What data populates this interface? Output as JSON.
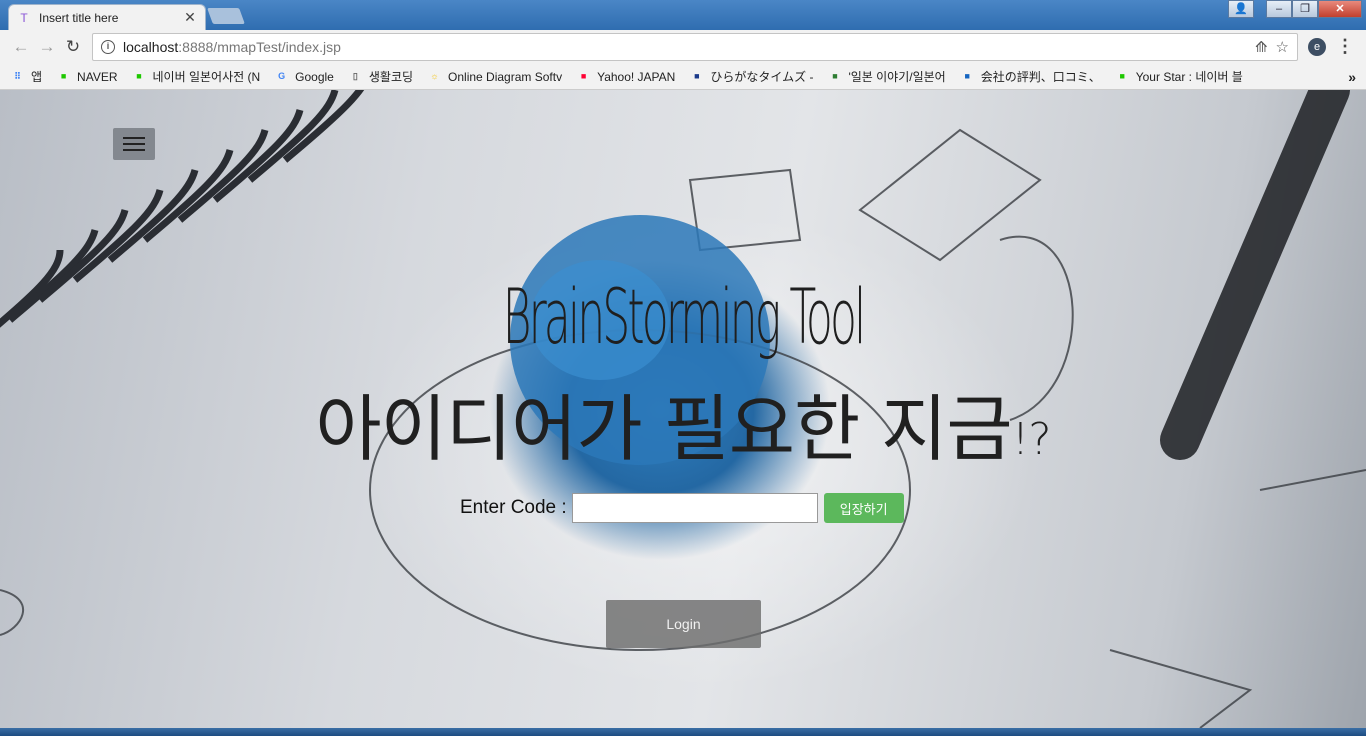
{
  "browser": {
    "tab": {
      "title": "Insert title here",
      "favicon": "T"
    },
    "address": {
      "host": "localhost",
      "path": ":8888/mmapTest/index.jsp"
    },
    "bookmarks": [
      {
        "label": "앱",
        "icon": "apps-icon",
        "color": "#4285f4"
      },
      {
        "label": "NAVER",
        "icon": "naver-icon",
        "color": "#1ec800"
      },
      {
        "label": "네이버 일본어사전 (N",
        "icon": "naver-dict-icon",
        "color": "#1ec800"
      },
      {
        "label": "Google",
        "icon": "google-icon",
        "color": "#4285f4"
      },
      {
        "label": "생활코딩",
        "icon": "page-icon",
        "color": "#666666"
      },
      {
        "label": "Online Diagram Softv",
        "icon": "bulb-icon",
        "color": "#f4c20d"
      },
      {
        "label": "Yahoo! JAPAN",
        "icon": "yahoo-icon",
        "color": "#ff0033"
      },
      {
        "label": "ひらがなタイムズ - ",
        "icon": "ht-icon",
        "color": "#1a3a8a"
      },
      {
        "label": "'일본 이야기/일본어",
        "icon": "blog-icon",
        "color": "#2e7d32"
      },
      {
        "label": "会社の評判、口コミ、",
        "icon": "chat-icon",
        "color": "#1565c0"
      },
      {
        "label": "Your Star : 네이버 블",
        "icon": "blog-naver-icon",
        "color": "#1ec800"
      }
    ]
  },
  "page": {
    "subtitle": "BrainStorming Tool",
    "title": "아이디어가 필요한 지금",
    "title_suffix": "!?",
    "code_label": "Enter Code :",
    "code_value": "",
    "enter_button": "입장하기",
    "login_button": "Login"
  },
  "colors": {
    "accent_green": "#5cb85c",
    "chrome_blue": "#2f6db0"
  }
}
